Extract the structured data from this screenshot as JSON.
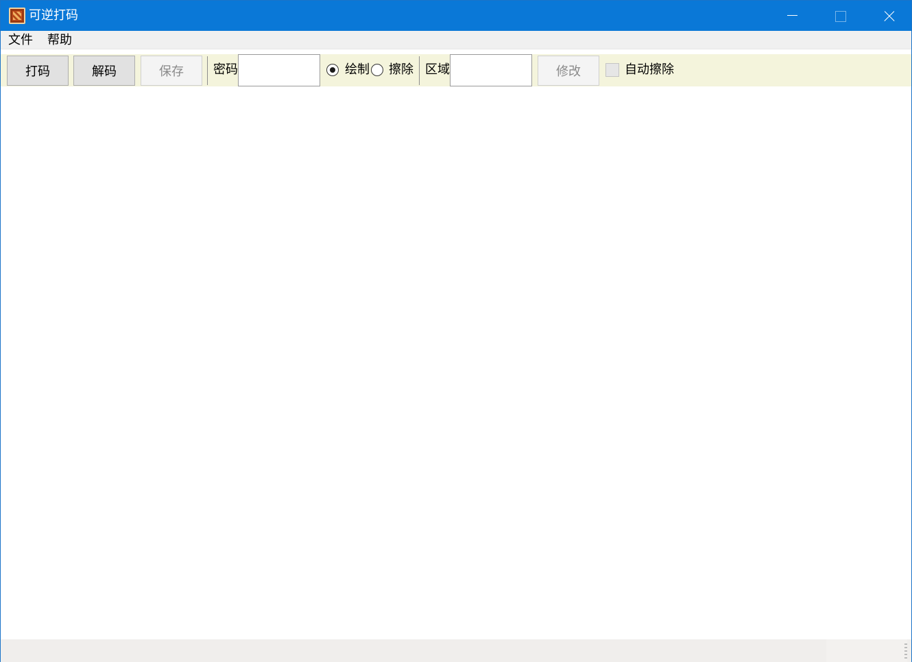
{
  "window": {
    "title": "可逆打码",
    "app_icon": "mosaic-icon"
  },
  "titlebar_controls": [
    "minimize-icon",
    "maximize-icon",
    "close-icon"
  ],
  "menu": {
    "file": "文件",
    "help": "帮助"
  },
  "toolbar": {
    "mosaic_label": "打码",
    "decode_label": "解码",
    "save_label": "保存",
    "password_label": "密码",
    "password_value": "",
    "draw_label": "绘制",
    "erase_label": "擦除",
    "mode_selected": "draw",
    "region_label": "区域",
    "region_value": "",
    "modify_label": "修改",
    "auto_erase_label": "自动擦除",
    "auto_erase_checked": false
  },
  "colors": {
    "titlebar": "#0a78d7",
    "toolbar_bg": "#f4f4dc",
    "menubar_bg": "#f0f0f0"
  }
}
